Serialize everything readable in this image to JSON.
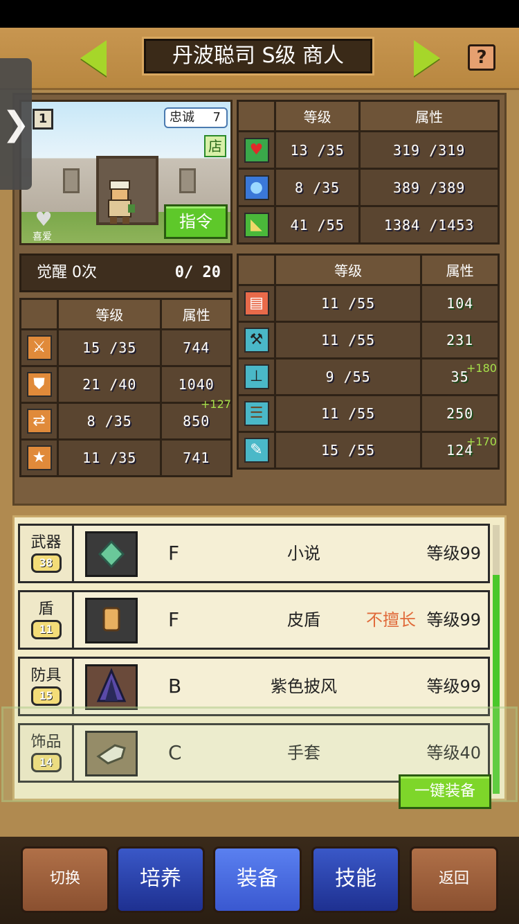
{
  "header": {
    "title": "丹波聪司 S级 商人",
    "help_label": "?",
    "side_tab_label": "❯"
  },
  "portrait": {
    "level_badge": "1",
    "loyalty_label": "忠诚",
    "loyalty_value": "7",
    "shop_label": "店",
    "favorite_label": "喜爱",
    "command_button": "指令"
  },
  "awakening": {
    "label": "觉醒 0次",
    "progress": "0/  20"
  },
  "top_stats": {
    "headers": [
      "等级",
      "属性"
    ],
    "rows": [
      {
        "icon": "heart-icon",
        "level": "13 /35",
        "value": "319 /319"
      },
      {
        "icon": "mana-potion-icon",
        "level": "8 /35",
        "value": "389 /389"
      },
      {
        "icon": "stamina-icon",
        "level": "41 /55",
        "value": "1384 /1453"
      }
    ]
  },
  "combat_stats": {
    "headers": [
      "等级",
      "属性"
    ],
    "rows": [
      {
        "icon": "attack-icon",
        "level": "15 /35",
        "value": "744",
        "bonus": ""
      },
      {
        "icon": "defense-icon",
        "level": "21 /40",
        "value": "1040",
        "bonus": "+127"
      },
      {
        "icon": "dexterity-icon",
        "level": "8 /35",
        "value": "850",
        "bonus": ""
      },
      {
        "icon": "luck-icon",
        "level": "11 /35",
        "value": "741",
        "bonus": ""
      }
    ]
  },
  "skill_stats": {
    "headers": [
      "等级",
      "属性"
    ],
    "rows": [
      {
        "icon": "book-icon",
        "level": "11 /55",
        "value": "104",
        "bonus": ""
      },
      {
        "icon": "hammer-icon",
        "level": "11 /55",
        "value": "231",
        "bonus": "+180"
      },
      {
        "icon": "shovel-icon",
        "level": "9 /55",
        "value": "35",
        "bonus": ""
      },
      {
        "icon": "pot-icon",
        "level": "11 /55",
        "value": "250",
        "bonus": "+170"
      },
      {
        "icon": "scroll-icon",
        "level": "15 /55",
        "value": "124",
        "bonus": ""
      }
    ]
  },
  "equipment": {
    "rows": [
      {
        "slot": "武器",
        "count": "38",
        "grade": "F",
        "name": "小说",
        "tag": "",
        "level": "等级99"
      },
      {
        "slot": "盾",
        "count": "11",
        "grade": "F",
        "name": "皮盾",
        "tag": "不擅长",
        "level": "等级99"
      },
      {
        "slot": "防具",
        "count": "15",
        "grade": "B",
        "name": "紫色披风",
        "tag": "",
        "level": "等级99"
      },
      {
        "slot": "饰品",
        "count": "14",
        "grade": "C",
        "name": "手套",
        "tag": "",
        "level": "等级40"
      }
    ],
    "equip_all_button": "一键装备"
  },
  "nav": {
    "switch": "切换",
    "train": "培养",
    "equip": "装备",
    "skill": "技能",
    "back": "返回"
  },
  "colors": {
    "accent_green": "#5ec82a",
    "panel_brown": "#7a5e3e",
    "nav_blue": "#1e3090",
    "warning_orange": "#e06a3a"
  }
}
